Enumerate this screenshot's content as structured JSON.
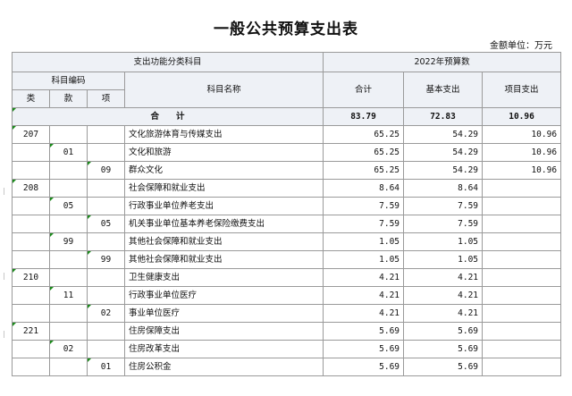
{
  "title": "一般公共预算支出表",
  "unit_label": "金额单位：万元",
  "header": {
    "func_group": "支出功能分类科目",
    "budget_group": "2022年预算数",
    "code_group": "科目编码",
    "lei": "类",
    "kuan": "款",
    "xiang": "项",
    "name": "科目名称",
    "total": "合计",
    "basic": "基本支出",
    "project": "项目支出"
  },
  "total_row": {
    "label": "合　　计",
    "total": "83.79",
    "basic": "72.83",
    "project": "10.96"
  },
  "rows": [
    {
      "lei": "207",
      "kuan": "",
      "xiang": "",
      "name": "文化旅游体育与传媒支出",
      "total": "65.25",
      "basic": "54.29",
      "project": "10.96"
    },
    {
      "lei": "",
      "kuan": "01",
      "xiang": "",
      "name": "文化和旅游",
      "total": "65.25",
      "basic": "54.29",
      "project": "10.96"
    },
    {
      "lei": "",
      "kuan": "",
      "xiang": "09",
      "name": "群众文化",
      "total": "65.25",
      "basic": "54.29",
      "project": "10.96"
    },
    {
      "lei": "208",
      "kuan": "",
      "xiang": "",
      "name": "社会保障和就业支出",
      "total": "8.64",
      "basic": "8.64",
      "project": ""
    },
    {
      "lei": "",
      "kuan": "05",
      "xiang": "",
      "name": "行政事业单位养老支出",
      "total": "7.59",
      "basic": "7.59",
      "project": ""
    },
    {
      "lei": "",
      "kuan": "",
      "xiang": "05",
      "name": "机关事业单位基本养老保险缴费支出",
      "total": "7.59",
      "basic": "7.59",
      "project": ""
    },
    {
      "lei": "",
      "kuan": "99",
      "xiang": "",
      "name": "其他社会保障和就业支出",
      "total": "1.05",
      "basic": "1.05",
      "project": ""
    },
    {
      "lei": "",
      "kuan": "",
      "xiang": "99",
      "name": "其他社会保障和就业支出",
      "total": "1.05",
      "basic": "1.05",
      "project": ""
    },
    {
      "lei": "210",
      "kuan": "",
      "xiang": "",
      "name": "卫生健康支出",
      "total": "4.21",
      "basic": "4.21",
      "project": ""
    },
    {
      "lei": "",
      "kuan": "11",
      "xiang": "",
      "name": "行政事业单位医疗",
      "total": "4.21",
      "basic": "4.21",
      "project": ""
    },
    {
      "lei": "",
      "kuan": "",
      "xiang": "02",
      "name": "事业单位医疗",
      "total": "4.21",
      "basic": "4.21",
      "project": ""
    },
    {
      "lei": "221",
      "kuan": "",
      "xiang": "",
      "name": "住房保障支出",
      "total": "5.69",
      "basic": "5.69",
      "project": ""
    },
    {
      "lei": "",
      "kuan": "02",
      "xiang": "",
      "name": "住房改革支出",
      "total": "5.69",
      "basic": "5.69",
      "project": ""
    },
    {
      "lei": "",
      "kuan": "",
      "xiang": "01",
      "name": "住房公积金",
      "total": "5.69",
      "basic": "5.69",
      "project": ""
    }
  ]
}
